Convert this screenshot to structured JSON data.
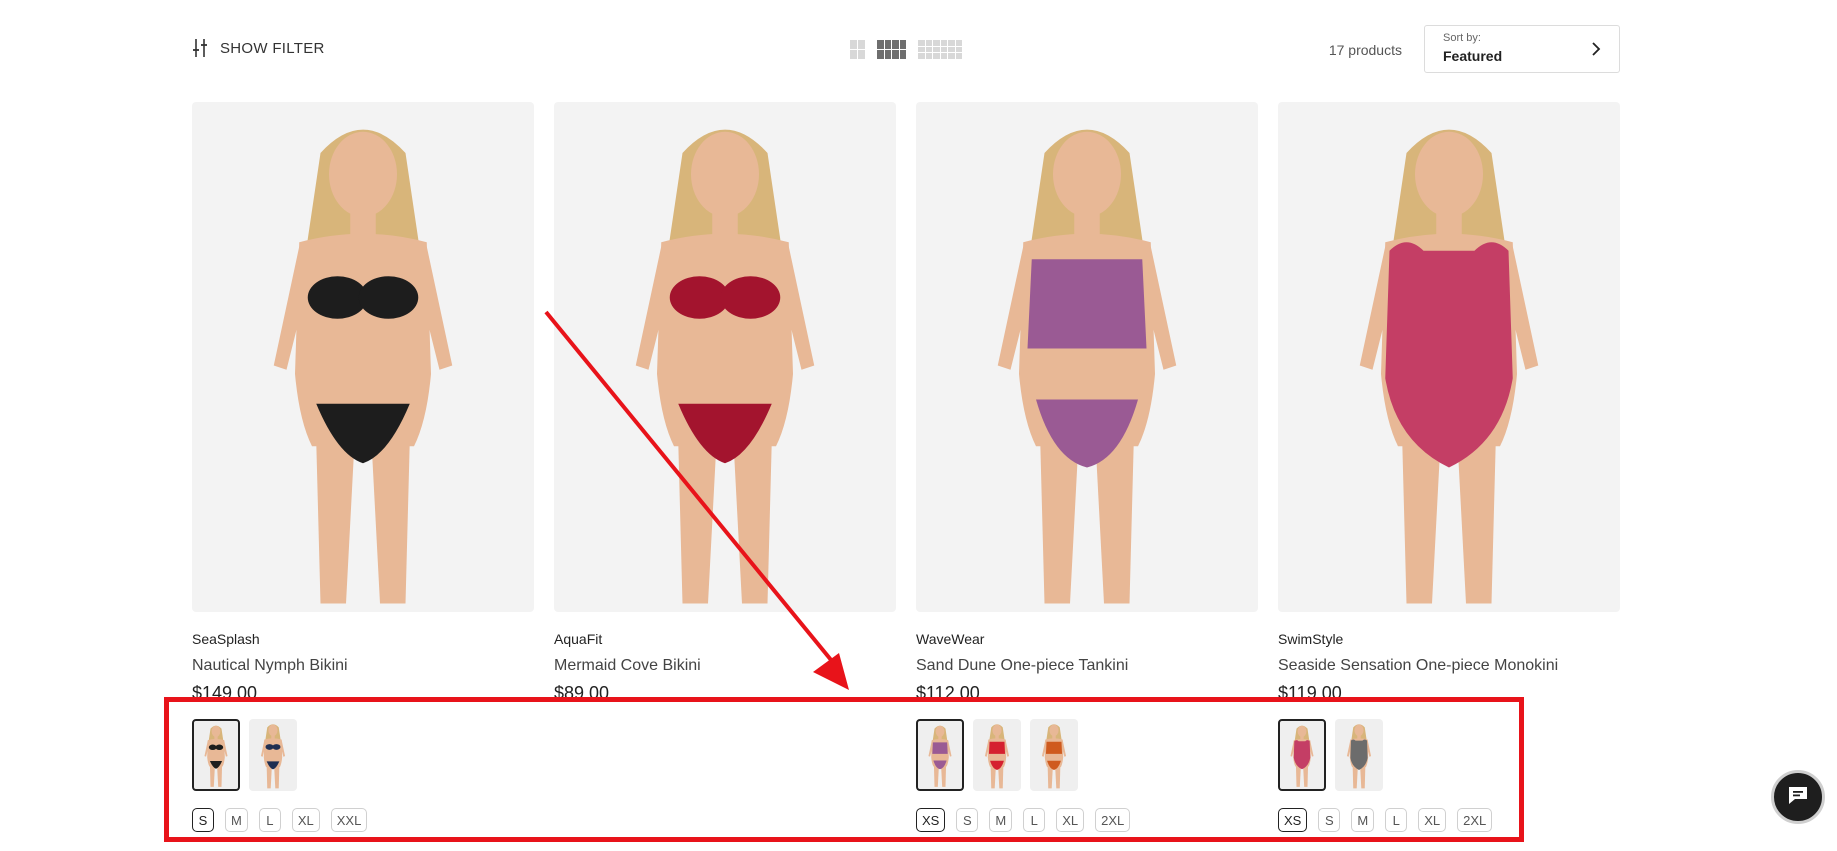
{
  "toolbar": {
    "filter_label": "SHOW FILTER",
    "product_count": "17 products",
    "sort_label": "Sort by:",
    "sort_value": "Featured"
  },
  "products": [
    {
      "brand": "SeaSplash",
      "title": "Nautical Nymph Bikini",
      "price": "$149.00",
      "color": "#1d1d1d",
      "style": "bikini",
      "sizes": [
        "S",
        "M",
        "L",
        "XL",
        "XXL"
      ],
      "swatches": [
        "#1d1d1d",
        "#1f2f52"
      ]
    },
    {
      "brand": "AquaFit",
      "title": "Mermaid Cove Bikini",
      "price": "$89.00",
      "color": "#a3142e",
      "style": "bikini",
      "sizes": [],
      "swatches": []
    },
    {
      "brand": "WaveWear",
      "title": "Sand Dune One-piece Tankini",
      "price": "$112.00",
      "color": "#9a5a94",
      "style": "tankini",
      "sizes": [
        "XS",
        "S",
        "M",
        "L",
        "XL",
        "2XL"
      ],
      "swatches": [
        "#9a5a94",
        "#d5202f",
        "#cf5a1e"
      ]
    },
    {
      "brand": "SwimStyle",
      "title": "Seaside Sensation One-piece Monokini",
      "price": "$119.00",
      "color": "#c43e65",
      "style": "onepiece",
      "sizes": [
        "XS",
        "S",
        "M",
        "L",
        "XL",
        "2XL"
      ],
      "swatches": [
        "#c43e65",
        "#6c6c6c"
      ]
    }
  ],
  "chat": {
    "icon": "chat-icon"
  },
  "annotation": {
    "color": "#e8131a"
  }
}
